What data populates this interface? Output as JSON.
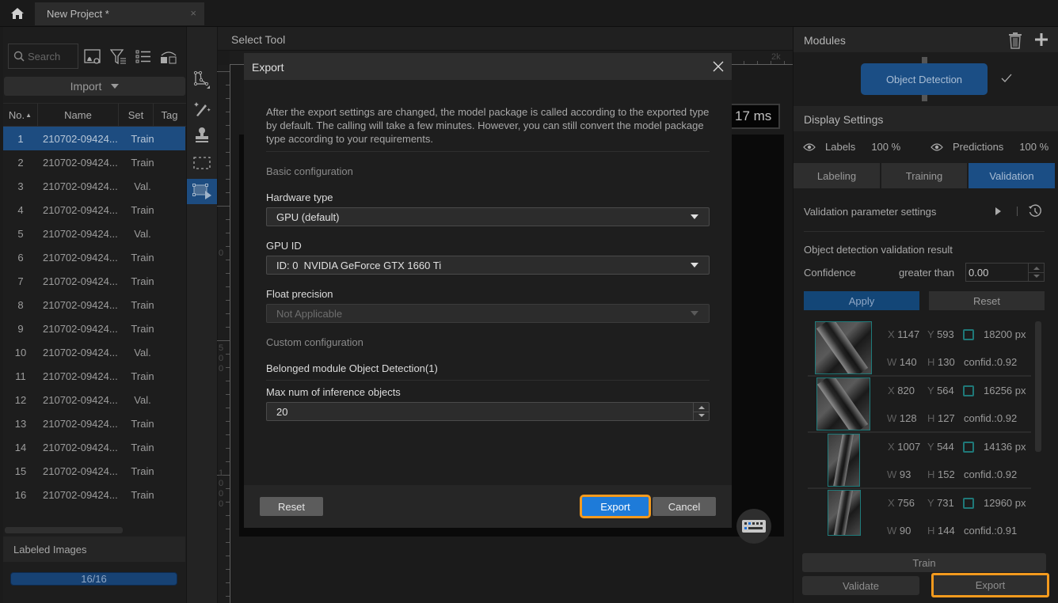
{
  "app": {
    "project_tab": "New Project *",
    "close_glyph": "×"
  },
  "left_panel": {
    "search_placeholder": "Search",
    "import_label": "Import",
    "columns": [
      "No.",
      "Name",
      "Set",
      "Tag"
    ],
    "rows": [
      {
        "no": "1",
        "name": "210702-09424...",
        "set": "Train",
        "selected": true
      },
      {
        "no": "2",
        "name": "210702-09424...",
        "set": "Train"
      },
      {
        "no": "3",
        "name": "210702-09424...",
        "set": "Val."
      },
      {
        "no": "4",
        "name": "210702-09424...",
        "set": "Train"
      },
      {
        "no": "5",
        "name": "210702-09424...",
        "set": "Val."
      },
      {
        "no": "6",
        "name": "210702-09424...",
        "set": "Train"
      },
      {
        "no": "7",
        "name": "210702-09424...",
        "set": "Train"
      },
      {
        "no": "8",
        "name": "210702-09424...",
        "set": "Train"
      },
      {
        "no": "9",
        "name": "210702-09424...",
        "set": "Train"
      },
      {
        "no": "10",
        "name": "210702-09424...",
        "set": "Val."
      },
      {
        "no": "11",
        "name": "210702-09424...",
        "set": "Train"
      },
      {
        "no": "12",
        "name": "210702-09424...",
        "set": "Val."
      },
      {
        "no": "13",
        "name": "210702-09424...",
        "set": "Train"
      },
      {
        "no": "14",
        "name": "210702-09424...",
        "set": "Train"
      },
      {
        "no": "15",
        "name": "210702-09424...",
        "set": "Train"
      },
      {
        "no": "16",
        "name": "210702-09424...",
        "set": "Train"
      }
    ],
    "labeled_images_title": "Labeled Images",
    "labeled_progress_text": "16/16",
    "labeled_progress_fraction": 1.0
  },
  "canvas": {
    "select_tool_label": "Select Tool",
    "inference_time": "17 ms",
    "ruler_top_label": "2k",
    "ruler_left_labels": [
      "0",
      "500",
      "1000"
    ]
  },
  "export_dialog": {
    "title": "Export",
    "description": "After the export settings are changed, the model package is called according to the exported type by default. The calling will take a few minutes. However, you can still convert the model package type according to your requirements.",
    "basic_section": "Basic configuration",
    "hardware_label": "Hardware type",
    "hardware_value": "GPU (default)",
    "gpu_id_label": "GPU ID",
    "gpu_id_value": "ID: 0  NVIDIA GeForce GTX 1660 Ti",
    "float_label": "Float precision",
    "float_value": "Not Applicable",
    "custom_section": "Custom configuration",
    "belonged_module": "Belonged module Object Detection(1)",
    "max_objects_label": "Max num of inference objects",
    "max_objects_value": "20",
    "reset_label": "Reset",
    "export_label": "Export",
    "cancel_label": "Cancel"
  },
  "right_panel": {
    "modules_title": "Modules",
    "module_name": "Object Detection",
    "display_settings_title": "Display Settings",
    "labels_label": "Labels",
    "labels_opacity": "100 %",
    "predictions_label": "Predictions",
    "predictions_opacity": "100 %",
    "tabs": [
      "Labeling",
      "Training",
      "Validation"
    ],
    "active_tab": "Validation",
    "validation_params_label": "Validation parameter settings",
    "result_title": "Object detection validation result",
    "confidence_label": "Confidence",
    "greater_than_label": "greater than",
    "confidence_value": "0.00",
    "apply_label": "Apply",
    "reset_label": "Reset",
    "results": [
      {
        "x": "1147",
        "y": "593",
        "w": "140",
        "h": "130",
        "area": "18200 px",
        "conf": "confid.:0.92"
      },
      {
        "x": "820",
        "y": "564",
        "w": "128",
        "h": "127",
        "area": "16256 px",
        "conf": "confid.:0.92"
      },
      {
        "x": "1007",
        "y": "544",
        "w": "93",
        "h": "152",
        "area": "14136 px",
        "conf": "confid.:0.92"
      },
      {
        "x": "756",
        "y": "731",
        "w": "90",
        "h": "144",
        "area": "12960 px",
        "conf": "confid.:0.91"
      }
    ],
    "train_label": "Train",
    "validate_label": "Validate",
    "export_label": "Export"
  },
  "colors": {
    "accent_blue": "#1d4c80",
    "primary_button": "#1e7bd9",
    "highlight_orange": "#f39a1e",
    "result_teal": "#1f7878"
  }
}
